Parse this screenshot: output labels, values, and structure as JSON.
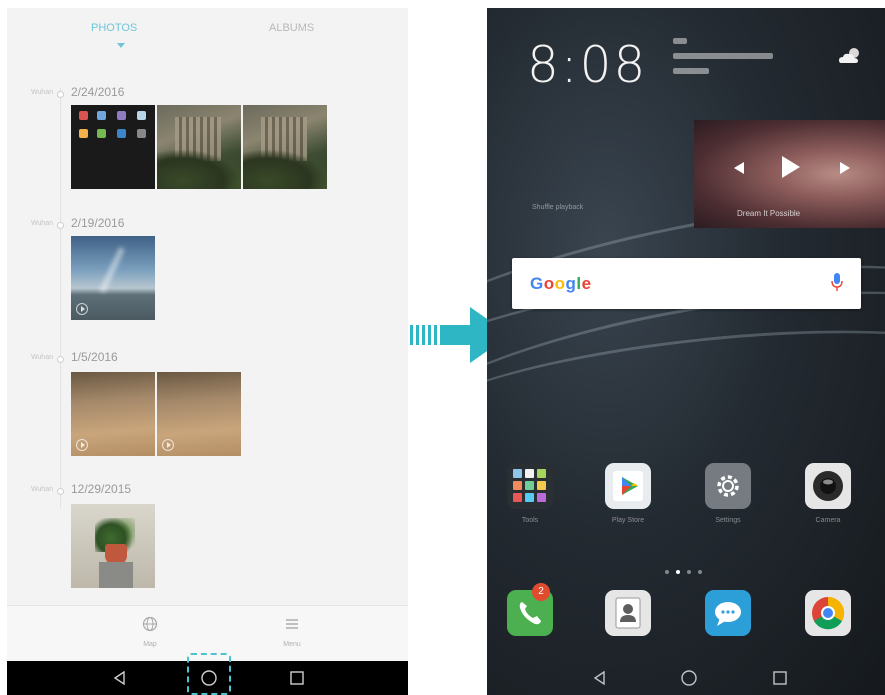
{
  "gallery": {
    "tabs": [
      {
        "label": "PHOTOS",
        "active": true
      },
      {
        "label": "ALBUMS",
        "active": false
      }
    ],
    "groups": [
      {
        "location": "Wuhan",
        "date": "2/24/2016"
      },
      {
        "location": "Wuhan",
        "date": "2/19/2016"
      },
      {
        "location": "Wuhan",
        "date": "1/5/2016"
      },
      {
        "location": "Wuhan",
        "date": "12/29/2015"
      }
    ],
    "bottom_menu": {
      "map_label": "Map",
      "menu_label": "Menu"
    },
    "highlight_color": "#4cc3d1"
  },
  "home": {
    "clock": "8:08",
    "music_widget": {
      "caption": "Shuffle playback",
      "title": "Dream It Possible"
    },
    "search": {
      "brand": "Google"
    },
    "apps": [
      {
        "label": "Tools",
        "icon": "tools-folder-icon"
      },
      {
        "label": "Play Store",
        "icon": "play-store-icon"
      },
      {
        "label": "Settings",
        "icon": "settings-gear-icon"
      },
      {
        "label": "Camera",
        "icon": "camera-icon"
      }
    ],
    "dock": [
      {
        "label": "Phone",
        "icon": "phone-icon",
        "badge": "2"
      },
      {
        "label": "Contacts",
        "icon": "contacts-icon"
      },
      {
        "label": "Messaging",
        "icon": "messaging-icon"
      },
      {
        "label": "Chrome",
        "icon": "chrome-icon"
      }
    ],
    "page_indicator": {
      "pages": 4,
      "current": 2
    }
  },
  "transition_arrow_color": "#2fb6c4"
}
